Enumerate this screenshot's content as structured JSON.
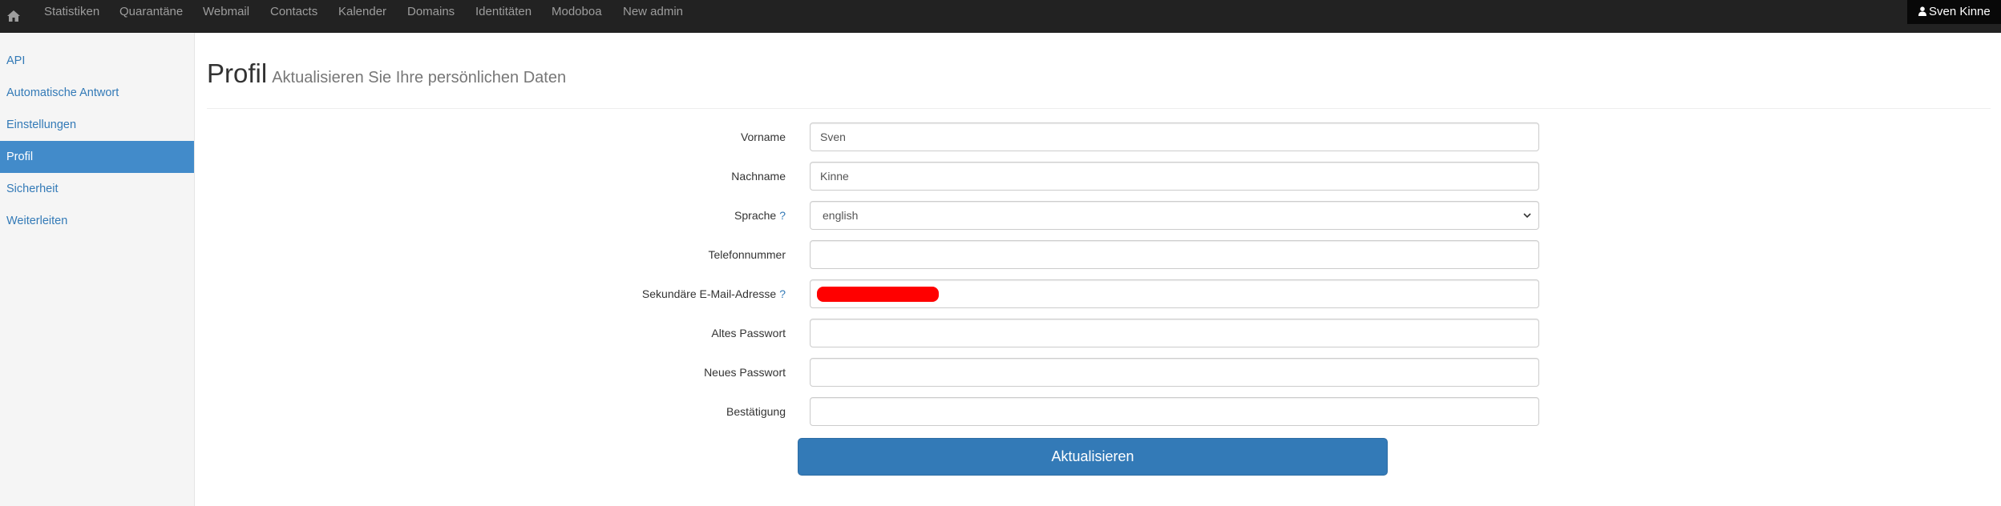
{
  "navbar": {
    "items": [
      {
        "label": "Statistiken"
      },
      {
        "label": "Quarantäne"
      },
      {
        "label": "Webmail"
      },
      {
        "label": "Contacts"
      },
      {
        "label": "Kalender"
      },
      {
        "label": "Domains"
      },
      {
        "label": "Identitäten"
      },
      {
        "label": "Modoboa"
      },
      {
        "label": "New admin"
      }
    ],
    "user": "Sven Kinne",
    "home_icon": "home-icon",
    "user_icon": "user-icon"
  },
  "sidebar": {
    "items": [
      {
        "label": "API"
      },
      {
        "label": "Automatische Antwort"
      },
      {
        "label": "Einstellungen"
      },
      {
        "label": "Profil",
        "active": true
      },
      {
        "label": "Sicherheit"
      },
      {
        "label": "Weiterleiten"
      }
    ]
  },
  "page": {
    "title": "Profil",
    "subtitle": "Aktualisieren Sie Ihre persönlichen Daten"
  },
  "form": {
    "first_name": {
      "label": "Vorname",
      "value": "Sven"
    },
    "last_name": {
      "label": "Nachname",
      "value": "Kinne"
    },
    "language": {
      "label": "Sprache",
      "help": "?",
      "value": "english",
      "options": [
        "english"
      ]
    },
    "phone": {
      "label": "Telefonnummer",
      "value": ""
    },
    "secondary_email": {
      "label": "Sekundäre E-Mail-Adresse",
      "help": "?",
      "value": ""
    },
    "old_password": {
      "label": "Altes Passwort",
      "value": ""
    },
    "new_password": {
      "label": "Neues Passwort",
      "value": ""
    },
    "confirmation": {
      "label": "Bestätigung",
      "value": ""
    },
    "submit_label": "Aktualisieren"
  },
  "colors": {
    "navbar_bg": "#222222",
    "accent": "#337ab7",
    "sidebar_active": "#428bca",
    "redaction": "#ff0000"
  }
}
